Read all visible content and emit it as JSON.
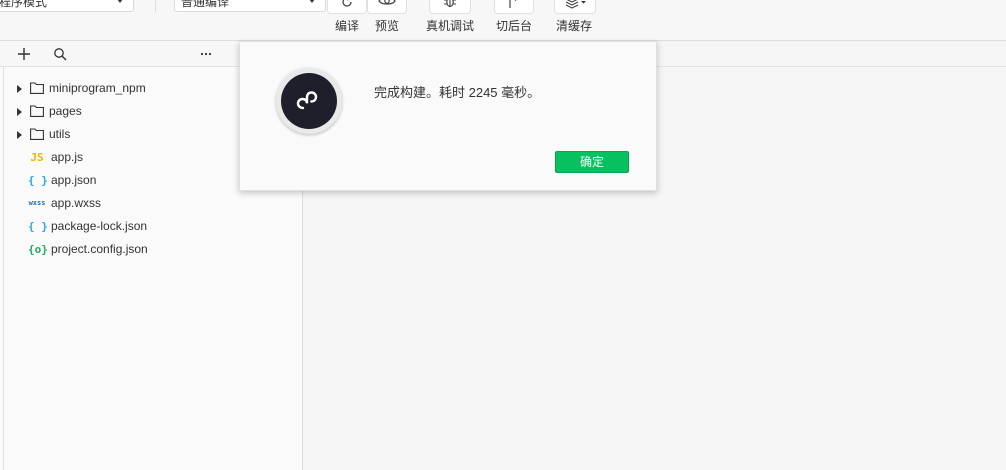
{
  "toolbar": {
    "mode_select": {
      "value": "程序模式"
    },
    "compile_select": {
      "value": "普通编译"
    },
    "buttons": [
      {
        "label": "编译",
        "icon": "refresh-icon"
      },
      {
        "label": "预览",
        "icon": "eye-icon"
      },
      {
        "label": "真机调试",
        "icon": "bug-icon"
      },
      {
        "label": "切后台",
        "icon": "switch-background-icon"
      },
      {
        "label": "清缓存",
        "icon": "layers-icon"
      }
    ]
  },
  "sidebar": {
    "header_icons": [
      "add-icon",
      "search-icon",
      "more-icon"
    ],
    "tree": [
      {
        "type": "folder",
        "name": "miniprogram_npm",
        "icon": "folder-icon"
      },
      {
        "type": "folder",
        "name": "pages",
        "icon": "folder-icon"
      },
      {
        "type": "folder",
        "name": "utils",
        "icon": "folder-icon"
      },
      {
        "type": "file",
        "name": "app.js",
        "badge": "JS",
        "badge_color": "#f0b400"
      },
      {
        "type": "file",
        "name": "app.json",
        "badge": "{ }",
        "badge_color": "#2aa7e0"
      },
      {
        "type": "file",
        "name": "app.wxss",
        "badge": "wxss",
        "badge_color": "#2b6fb6"
      },
      {
        "type": "file",
        "name": "package-lock.json",
        "badge": "{ }",
        "badge_color": "#2aa7e0"
      },
      {
        "type": "file",
        "name": "project.config.json",
        "badge": "{o}",
        "badge_color": "#1aad5d"
      }
    ]
  },
  "dialog": {
    "logo_icon": "miniprogram-logo-icon",
    "message": "完成构建。耗时 2245 毫秒。",
    "ok_label": "确定",
    "ok_color": "#07c160"
  }
}
